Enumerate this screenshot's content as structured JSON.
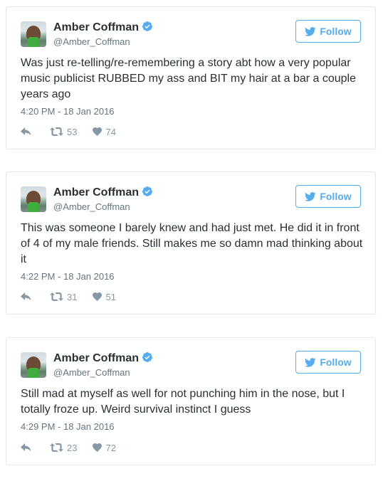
{
  "colors": {
    "twitter_blue": "#55acee",
    "text": "#292f33",
    "muted": "#66757f",
    "icon": "#8899a6",
    "border": "#e1e8ed"
  },
  "icons": {
    "verified": "verified-badge-icon",
    "follow": "twitter-bird-icon",
    "reply": "reply-icon",
    "retweet": "retweet-icon",
    "like": "heart-icon"
  },
  "tweets": [
    {
      "name": "Amber Coffman",
      "handle": "@Amber_Coffman",
      "follow_label": "Follow",
      "text": "Was just re-telling/re-remembering a story abt how a very popular music publicist RUBBED my ass and BIT my hair at a bar a couple years ago",
      "timestamp": "4:20 PM - 18 Jan 2016",
      "retweets": "53",
      "likes": "74"
    },
    {
      "name": "Amber Coffman",
      "handle": "@Amber_Coffman",
      "follow_label": "Follow",
      "text": "This was someone I barely knew and had just met. He did it in front of 4 of my male friends. Still makes me so damn mad thinking about it",
      "timestamp": "4:22 PM - 18 Jan 2016",
      "retweets": "31",
      "likes": "51"
    },
    {
      "name": "Amber Coffman",
      "handle": "@Amber_Coffman",
      "follow_label": "Follow",
      "text": "Still mad at myself as well for not punching him in the nose, but I totally froze up. Weird survival instinct I guess",
      "timestamp": "4:29 PM - 18 Jan 2016",
      "retweets": "23",
      "likes": "72"
    }
  ]
}
